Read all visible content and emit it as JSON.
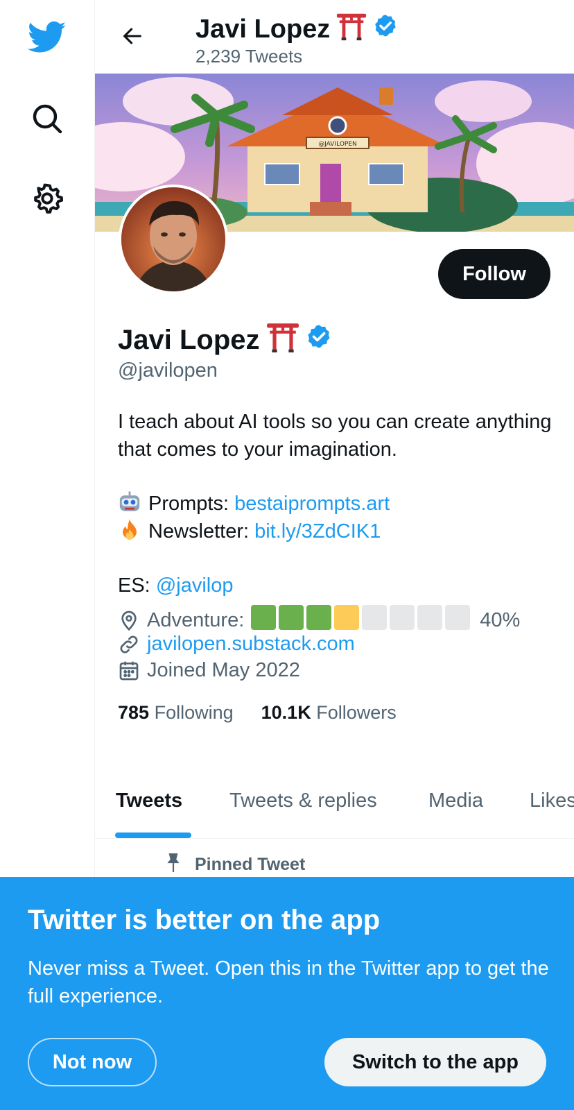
{
  "sidebar": {
    "icons": [
      "twitter-bird-logo",
      "search-icon",
      "settings-gear-icon"
    ]
  },
  "header": {
    "name": "Javi Lopez",
    "tweet_count": "2,239 Tweets",
    "back_icon": "arrow-left-icon"
  },
  "banner": {
    "sign_text": "@JAVILOPEN"
  },
  "profile": {
    "name": "Javi Lopez",
    "emoji": "⛩",
    "handle": "@javilopen",
    "follow_label": "Follow",
    "bio_line1": "I teach about AI tools so you can create anything that comes to your imagination.",
    "prompts_label": "Prompts:",
    "prompts_link": "bestaiprompts.art",
    "newsletter_label": "Newsletter:",
    "newsletter_link": "bit.ly/3ZdCIK1",
    "es_label": "ES:",
    "es_link": "@javilop",
    "location_label": "Adventure:",
    "adventure_level": 0.4,
    "adventure_percent": "40%",
    "website": "javilopen.substack.com",
    "joined": "Joined May 2022",
    "following_count": "785",
    "following_label": "Following",
    "followers_count": "10.1K",
    "followers_label": "Followers"
  },
  "tabs": [
    {
      "label": "Tweets",
      "active": true
    },
    {
      "label": "Tweets & replies",
      "active": false
    },
    {
      "label": "Media",
      "active": false
    },
    {
      "label": "Likes",
      "active": false
    }
  ],
  "pinned_label": "Pinned Tweet",
  "app_sheet": {
    "title": "Twitter is better on the app",
    "body": "Never miss a Tweet. Open this in the Twitter app to get the full experience.",
    "not_now": "Not now",
    "switch": "Switch to the app"
  },
  "colors": {
    "accent": "#1d9bf0",
    "text": "#0f1419",
    "secondary": "#536471",
    "green": "#6ab04c",
    "yellow": "#fdcb58",
    "gray": "#e6e7e8"
  }
}
